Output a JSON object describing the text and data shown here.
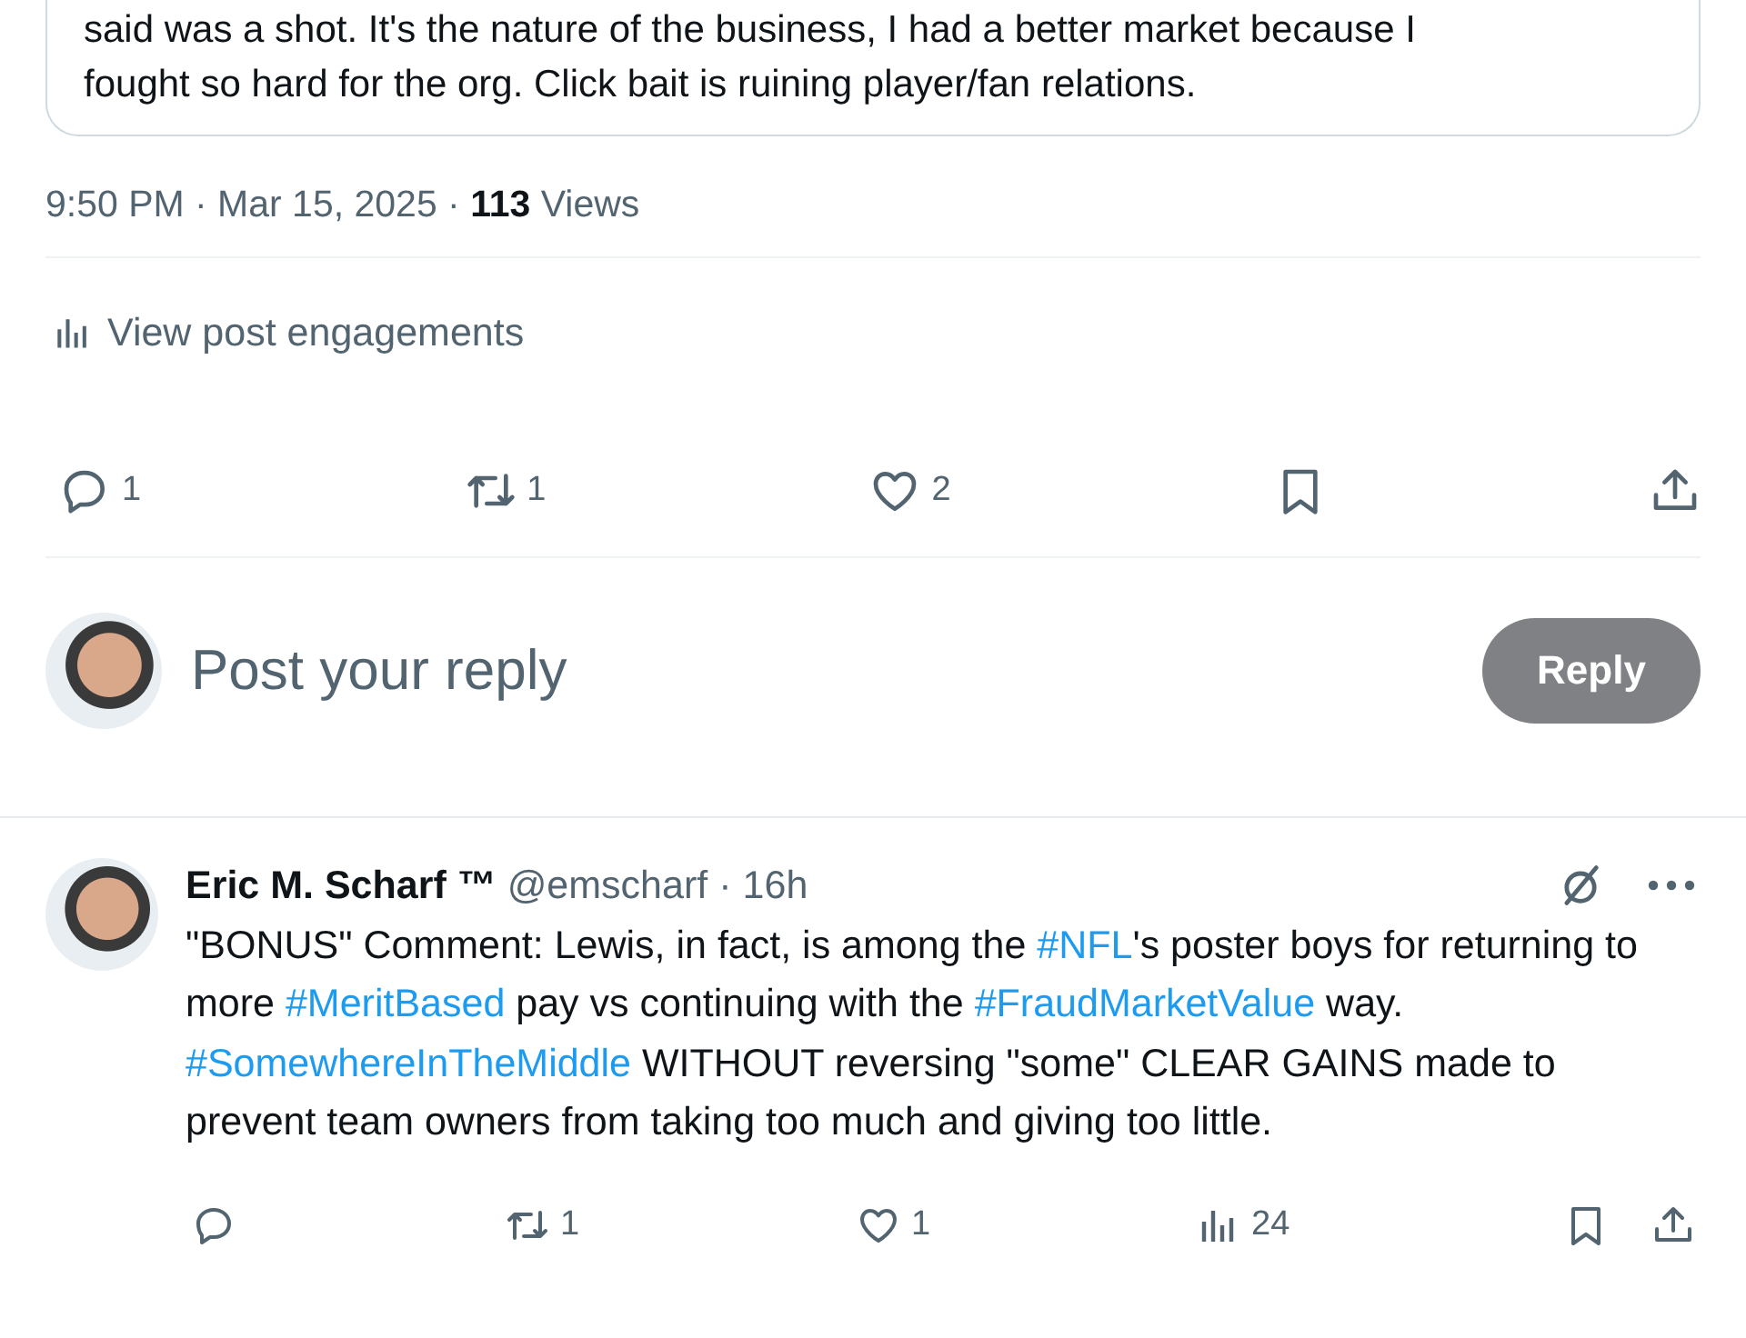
{
  "quoted_post": {
    "lines": [
      "said was a shot. It's the nature of the business, I had a better market because I",
      "fought so hard for the org. Click bait is ruining player/fan relations."
    ]
  },
  "post_meta": "9:50 PM · Mar 15, 2025 · **113** Views",
  "engagements_link": "View post engagements",
  "post_actions": [
    {
      "kind": "reply",
      "count": "1"
    },
    {
      "kind": "repost",
      "count": "1"
    },
    {
      "kind": "like",
      "count": "2"
    },
    {
      "kind": "bookmark"
    },
    {
      "kind": "share"
    }
  ],
  "reply_composer": {
    "placeholder": "Post your reply",
    "button": "Reply",
    "disabled": true
  },
  "reply": {
    "name": "Eric M. Scharf ™",
    "handle": "@emscharf",
    "separator": "·",
    "time": "16h",
    "body": [
      {
        "kind": "text",
        "text": "\"BONUS\" Comment: Lewis, in fact, is among the "
      },
      {
        "kind": "hashtag",
        "text": "#NFL"
      },
      {
        "kind": "text",
        "text": "'s poster boys for returning to more "
      },
      {
        "kind": "hashtag",
        "text": "#MeritBased"
      },
      {
        "kind": "text",
        "text": " pay vs continuing with the "
      },
      {
        "kind": "hashtag",
        "text": "#FraudMarketValue"
      },
      {
        "kind": "text",
        "text": " way. "
      },
      {
        "kind": "hashtag",
        "text": "#SomewhereInTheMiddle"
      },
      {
        "kind": "text",
        "text": " WITHOUT reversing \"some\" CLEAR GAINS made to prevent team owners from taking too much and giving too little."
      }
    ],
    "actions": [
      {
        "kind": "reply"
      },
      {
        "kind": "repost",
        "count": "1"
      },
      {
        "kind": "like",
        "count": "1"
      },
      {
        "kind": "views",
        "count": "24"
      },
      {
        "kind": "bookmark"
      },
      {
        "kind": "share"
      }
    ]
  }
}
